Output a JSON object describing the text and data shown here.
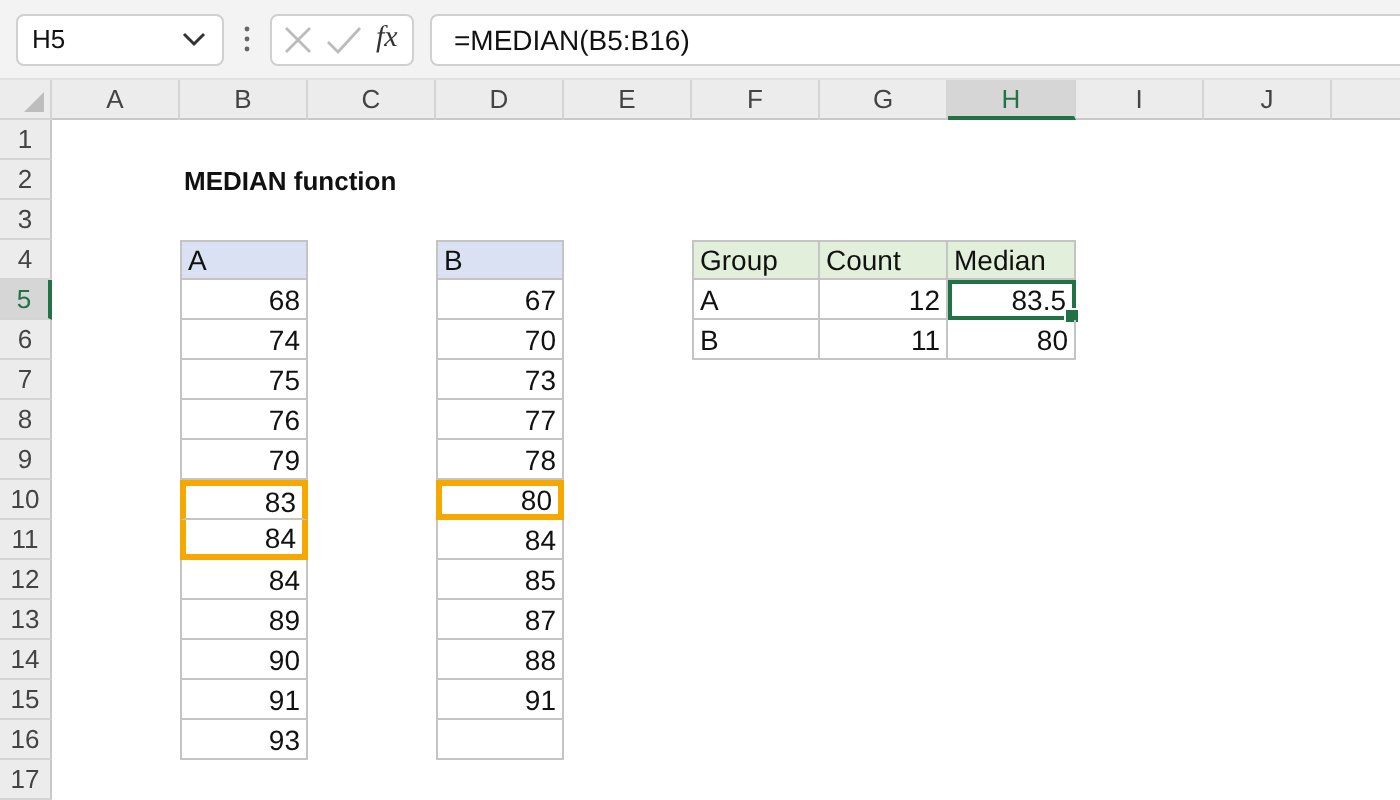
{
  "formula_bar": {
    "name_box": "H5",
    "fx_label": "fx",
    "formula": "=MEDIAN(B5:B16)"
  },
  "column_headers": [
    {
      "label": "A",
      "selected": false
    },
    {
      "label": "B",
      "selected": false
    },
    {
      "label": "C",
      "selected": false
    },
    {
      "label": "D",
      "selected": false
    },
    {
      "label": "E",
      "selected": false
    },
    {
      "label": "F",
      "selected": false
    },
    {
      "label": "G",
      "selected": false
    },
    {
      "label": "H",
      "selected": true
    },
    {
      "label": "I",
      "selected": false
    },
    {
      "label": "J",
      "selected": false
    }
  ],
  "row_headers": [
    {
      "label": "1",
      "selected": false
    },
    {
      "label": "2",
      "selected": false
    },
    {
      "label": "3",
      "selected": false
    },
    {
      "label": "4",
      "selected": false
    },
    {
      "label": "5",
      "selected": true
    },
    {
      "label": "6",
      "selected": false
    },
    {
      "label": "7",
      "selected": false
    },
    {
      "label": "8",
      "selected": false
    },
    {
      "label": "9",
      "selected": false
    },
    {
      "label": "10",
      "selected": false
    },
    {
      "label": "11",
      "selected": false
    },
    {
      "label": "12",
      "selected": false
    },
    {
      "label": "13",
      "selected": false
    },
    {
      "label": "14",
      "selected": false
    },
    {
      "label": "15",
      "selected": false
    },
    {
      "label": "16",
      "selected": false
    },
    {
      "label": "17",
      "selected": false
    }
  ],
  "title": "MEDIAN function",
  "list_a": {
    "header": "A",
    "values": [
      {
        "text": "68",
        "highlighted": false
      },
      {
        "text": "74",
        "highlighted": false
      },
      {
        "text": "75",
        "highlighted": false
      },
      {
        "text": "76",
        "highlighted": false
      },
      {
        "text": "79",
        "highlighted": false
      },
      {
        "text": "83",
        "highlighted": true
      },
      {
        "text": "84",
        "highlighted": true
      },
      {
        "text": "84",
        "highlighted": false
      },
      {
        "text": "89",
        "highlighted": false
      },
      {
        "text": "90",
        "highlighted": false
      },
      {
        "text": "91",
        "highlighted": false
      },
      {
        "text": "93",
        "highlighted": false
      }
    ]
  },
  "list_b": {
    "header": "B",
    "values": [
      {
        "text": "67",
        "highlighted": false
      },
      {
        "text": "70",
        "highlighted": false
      },
      {
        "text": "73",
        "highlighted": false
      },
      {
        "text": "77",
        "highlighted": false
      },
      {
        "text": "78",
        "highlighted": false
      },
      {
        "text": "80",
        "highlighted": true
      },
      {
        "text": "84",
        "highlighted": false
      },
      {
        "text": "85",
        "highlighted": false
      },
      {
        "text": "87",
        "highlighted": false
      },
      {
        "text": "88",
        "highlighted": false
      },
      {
        "text": "91",
        "highlighted": false
      }
    ]
  },
  "summary": {
    "columns": [
      {
        "label": "Group",
        "kind": "text"
      },
      {
        "label": "Count",
        "kind": "number"
      },
      {
        "label": "Median",
        "kind": "number"
      }
    ],
    "rows": [
      {
        "cells": [
          {
            "text": "A",
            "selected": false
          },
          {
            "text": "12",
            "selected": false
          },
          {
            "text": "83.5",
            "selected": true
          }
        ]
      },
      {
        "cells": [
          {
            "text": "B",
            "selected": false
          },
          {
            "text": "11",
            "selected": false
          },
          {
            "text": "80",
            "selected": false
          }
        ]
      }
    ]
  }
}
